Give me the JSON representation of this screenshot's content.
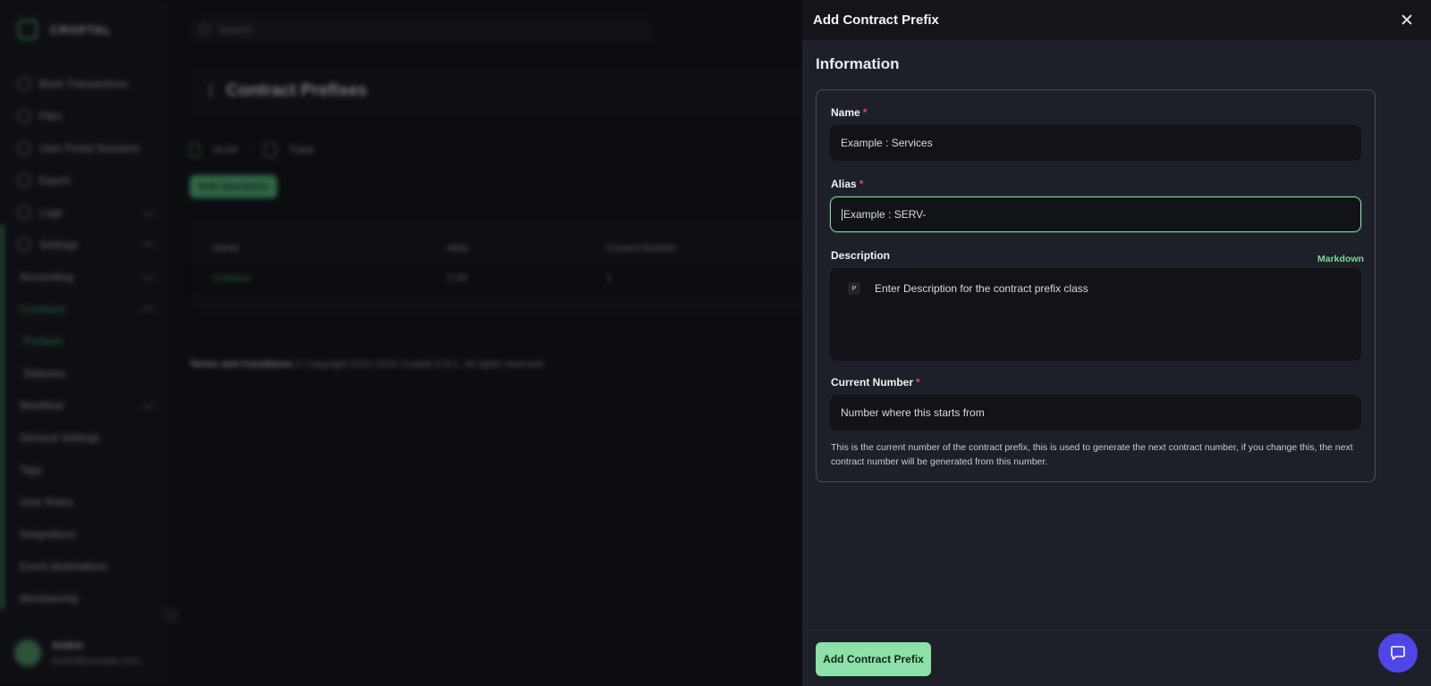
{
  "app": {
    "brand": "CROPTAL",
    "search_placeholder": "Search"
  },
  "sidebar": {
    "items": [
      {
        "label": "Bank Transactions"
      },
      {
        "label": "Files"
      },
      {
        "label": "User Portal Sessions"
      },
      {
        "label": "Export"
      },
      {
        "label": "Logs"
      },
      {
        "label": "Settings"
      },
      {
        "label": "Accounting"
      },
      {
        "label": "Contracts"
      },
      {
        "label": "Prefixes"
      },
      {
        "label": "Statuses"
      },
      {
        "label": "Workflow"
      },
      {
        "label": "General Settings"
      },
      {
        "label": "Tags"
      },
      {
        "label": "User Roles"
      },
      {
        "label": "Integrations"
      },
      {
        "label": "Event destinations"
      },
      {
        "label": "Membership"
      }
    ],
    "user": {
      "name": "Andrei",
      "email": "andrei@example.com..."
    }
  },
  "page": {
    "title": "Contract Prefixes",
    "toolbar": {
      "export_label": "XLSX",
      "trash_label": "Trash"
    },
    "bulk_label": "Bulk Operations",
    "table": {
      "headers": [
        "Name",
        "Alias",
        "Current Number"
      ],
      "rows": [
        {
          "name": "Contract",
          "alias": "CTR",
          "current": "1"
        }
      ]
    },
    "footer": {
      "terms": "Terms and Conditions",
      "copyright": "© Copyright 2021-2024 Croptal S.R.L. All rights reserved."
    }
  },
  "drawer": {
    "title": "Add Contract Prefix",
    "section": "Information",
    "name": {
      "label": "Name",
      "required": "*",
      "placeholder": "Example : Services"
    },
    "alias": {
      "label": "Alias",
      "required": "*",
      "placeholder": "Example : SERV-"
    },
    "description": {
      "label": "Description",
      "markdown": "Markdown",
      "block_type": "P",
      "placeholder": "Enter Description for the contract prefix class"
    },
    "current_number": {
      "label": "Current Number",
      "required": "*",
      "placeholder": "Number where this starts from",
      "help": "This is the current number of the contract prefix, this is used to generate the next contract number, if you change this, the next contract number will be generated from this number."
    },
    "submit_label": "Add Contract Prefix"
  },
  "colors": {
    "accent": "#8ee0a9",
    "focus_border": "#82dca0",
    "chat_fab": "#4f46e5",
    "required": "#e5484d"
  },
  "icons": {
    "close": "close-icon",
    "chat": "chat-icon",
    "search": "search-icon"
  }
}
